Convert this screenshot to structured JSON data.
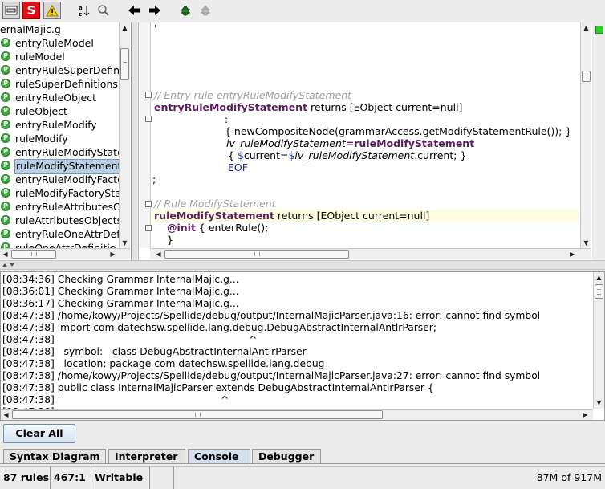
{
  "toolbar": {
    "buttons": [
      {
        "name": "rules-panel-toggle-button",
        "icon": "gear-box-icon"
      },
      {
        "name": "syntax-check-button",
        "icon": "s-icon",
        "label": "S",
        "color": "#e0101a"
      },
      {
        "name": "warning-toggle-button",
        "icon": "warning-icon",
        "color": "#f0d000"
      },
      {
        "name": "sort-rules-button",
        "icon": "sort-az-icon"
      },
      {
        "name": "find-button",
        "icon": "magnifier-icon"
      },
      {
        "name": "back-button",
        "icon": "arrow-left-icon"
      },
      {
        "name": "forward-button",
        "icon": "arrow-right-icon"
      },
      {
        "name": "debug-button",
        "icon": "bug-icon",
        "color": "#2b8a2b"
      },
      {
        "name": "debug-again-button",
        "icon": "bug-disabled-icon",
        "color": "#aaaaaa"
      }
    ]
  },
  "rules": {
    "file": "ernalMajic.g",
    "items": [
      {
        "label": "entryRuleModel",
        "selected": false
      },
      {
        "label": "ruleModel",
        "selected": false
      },
      {
        "label": "entryRuleSuperDefin",
        "selected": false
      },
      {
        "label": "ruleSuperDefinitions",
        "selected": false
      },
      {
        "label": "entryRuleObject",
        "selected": false
      },
      {
        "label": "ruleObject",
        "selected": false
      },
      {
        "label": "entryRuleModify",
        "selected": false
      },
      {
        "label": "ruleModify",
        "selected": false
      },
      {
        "label": "entryRuleModifyState",
        "selected": false
      },
      {
        "label": "ruleModifyStatement",
        "selected": true
      },
      {
        "label": "entryRuleModifyFacto",
        "selected": false
      },
      {
        "label": "ruleModifyFactorySta",
        "selected": false
      },
      {
        "label": "entryRuleAttributesO",
        "selected": false
      },
      {
        "label": "ruleAttributesObjects",
        "selected": false
      },
      {
        "label": "entryRuleOneAttrDef",
        "selected": false
      },
      {
        "label": "ruleOneAttrDefinitio",
        "selected": false
      }
    ]
  },
  "editor": {
    "lines": {
      "l0": "'",
      "l1_comment": "// Entry rule entryRuleModifyStatement",
      "l2_rule": "entryRuleModifyStatement",
      "l2_rest": " returns [EObject current=null]",
      "l3": ":",
      "l4": "{ newCompositeNode(grammarAccess.getModifyStatementRule()); }",
      "l5_var": "iv_ruleModifyStatement",
      "l5_eq": "=",
      "l5_rule": "ruleModifyStatement",
      "l6_open": "{ ",
      "l6_d1": "$",
      "l6_current": "current",
      "l6_eq": "=",
      "l6_d2": "$",
      "l6_var": "iv_ruleModifyStatement",
      "l6_tail": ".current; }",
      "l7": "EOF",
      "l8": ";",
      "l9_comment": "// Rule ModifyStatement",
      "l10_rule": "ruleModifyStatement",
      "l10_rest": " returns [EObject current=null]",
      "l11_init": "@init",
      "l11_rest": " { enterRule();",
      "l12": "}"
    }
  },
  "console": {
    "lines": [
      "[08:34:36] Checking Grammar InternalMajic.g...",
      "[08:36:01] Checking Grammar InternalMajic.g...",
      "[08:36:17] Checking Grammar InternalMajic.g...",
      "[08:47:38] /home/kowy/Projects/Spellide/debug/output/InternalMajicParser.java:16: error: cannot find symbol",
      "[08:47:38] import com.datechsw.spellide.lang.debug.DebugAbstractInternalAntlrParser;",
      "[08:47:38]                                                              ^",
      "[08:47:38]   symbol:   class DebugAbstractInternalAntlrParser",
      "[08:47:38]   location: package com.datechsw.spellide.lang.debug",
      "[08:47:38] /home/kowy/Projects/Spellide/debug/output/InternalMajicParser.java:27: error: cannot find symbol",
      "[08:47:38] public class InternalMajicParser extends DebugAbstractInternalAntlrParser {",
      "[08:47:38]                                                     ^",
      "[08:47:38]   ..."
    ],
    "clear_label": "Clear All"
  },
  "tabs": [
    {
      "label": "Syntax Diagram",
      "active": false
    },
    {
      "label": "Interpreter",
      "active": false
    },
    {
      "label": "Console",
      "active": true
    },
    {
      "label": "Debugger",
      "active": false
    }
  ],
  "status": {
    "rules_count": "87 rules",
    "cursor": "467:1",
    "mode": "Writable",
    "extra": "",
    "memory": "87M of 917M"
  },
  "colors": {
    "selection": "#b8cfe5",
    "rule_keyword": "#5a1d5e",
    "comment": "#a0a0a0",
    "active_tab": "#d3dfeb",
    "ok_marker": "#2dcc2d"
  }
}
